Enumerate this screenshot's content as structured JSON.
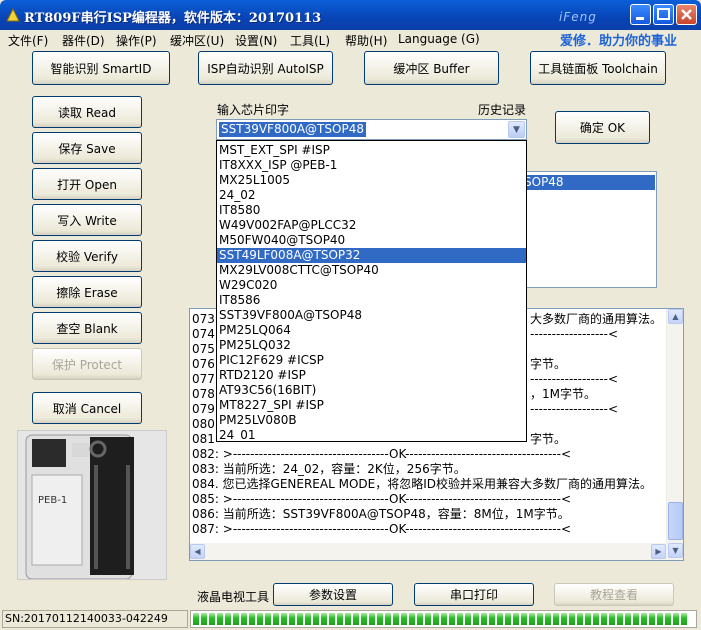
{
  "window": {
    "title": "RT809F串行ISP编程器，软件版本：20170113",
    "watermark": "iFeng"
  },
  "menu": {
    "items": [
      "文件(F)",
      "器件(D)",
      "操作(P)",
      "缓冲区(U)",
      "设置(N)",
      "工具(L)",
      "帮助(H)",
      "Language (G)"
    ],
    "slogan": "爱修．助力你的事业"
  },
  "toolbar": {
    "smartid": "智能识别 SmartID",
    "autoisp": "ISP自动识别 AutoISP",
    "buffer": "缓冲区 Buffer",
    "toolchain": "工具链面板 Toolchain"
  },
  "actions": {
    "read": "读取 Read",
    "save": "保存 Save",
    "open": "打开 Open",
    "write": "写入 Write",
    "verify": "校验 Verify",
    "erase": "擦除 Erase",
    "blank": "查空 Blank",
    "protect": "保护 Protect",
    "cancel": "取消 Cancel"
  },
  "chip_input": {
    "label": "输入芯片印字",
    "history_label": "历史记录",
    "value": "SST39VF800A@TSOP48",
    "ok_label": "确定 OK"
  },
  "history": {
    "selected_partial": "SOP48"
  },
  "dropdown_options": [
    "MST_EXT_SPI #ISP",
    "IT8XXX_ISP @PEB-1",
    "MX25L1005",
    "24_02",
    "IT8580",
    "W49V002FAP@PLCC32",
    "M50FW040@TSOP40",
    "SST49LF008A@TSOP32",
    "MX29LV008CTTC@TSOP40",
    "W29C020",
    "IT8586",
    "SST39VF800A@TSOP48",
    "PM25LQ064",
    "PM25LQ032",
    "PIC12F629 #ICSP",
    "RTD2120 #ISP",
    "AT93C56(16BIT)",
    "MT8227_SPI #ISP",
    "PM25LV080B",
    "24_01"
  ],
  "dropdown_highlight_index": 7,
  "log_lines": [
    {
      "left": "073",
      "right": "大多数厂商的通用算法。"
    },
    {
      "left": "074",
      "right": "------------------<"
    },
    {
      "left": "075",
      "right": ""
    },
    {
      "left": "076",
      "right": "字节。"
    },
    {
      "left": "077",
      "right": "------------------<"
    },
    {
      "left": "078",
      "right": "，1M字节。"
    },
    {
      "left": "079",
      "right": "------------------<"
    },
    {
      "left": "080",
      "right": ""
    },
    {
      "left": "081",
      "right": "字节。"
    },
    {
      "left": "082: >------------------------------------OK------------------------------------<",
      "right": ""
    },
    {
      "left": "083: 当前所选：24_02，容量：2K位，256字节。",
      "right": ""
    },
    {
      "left": "084. 您已选择GENEREAL MODE，将忽略ID校验并采用兼容大多数厂商的通用算法。",
      "right": ""
    },
    {
      "left": "085: >------------------------------------OK------------------------------------<",
      "right": ""
    },
    {
      "left": "086: 当前所选：SST39VF800A@TSOP48，容量：8M位，1M字节。",
      "right": ""
    },
    {
      "left": "087: >------------------------------------OK------------------------------------<",
      "right": ""
    }
  ],
  "bottom": {
    "lcd_tools": "液晶电视工具",
    "params": "参数设置",
    "serial_print": "串口打印",
    "tutorial": "教程查看"
  },
  "device_image_label": "PEB-1",
  "status": {
    "sn": "SN:20170112140033-042249",
    "progress": 1.0
  }
}
